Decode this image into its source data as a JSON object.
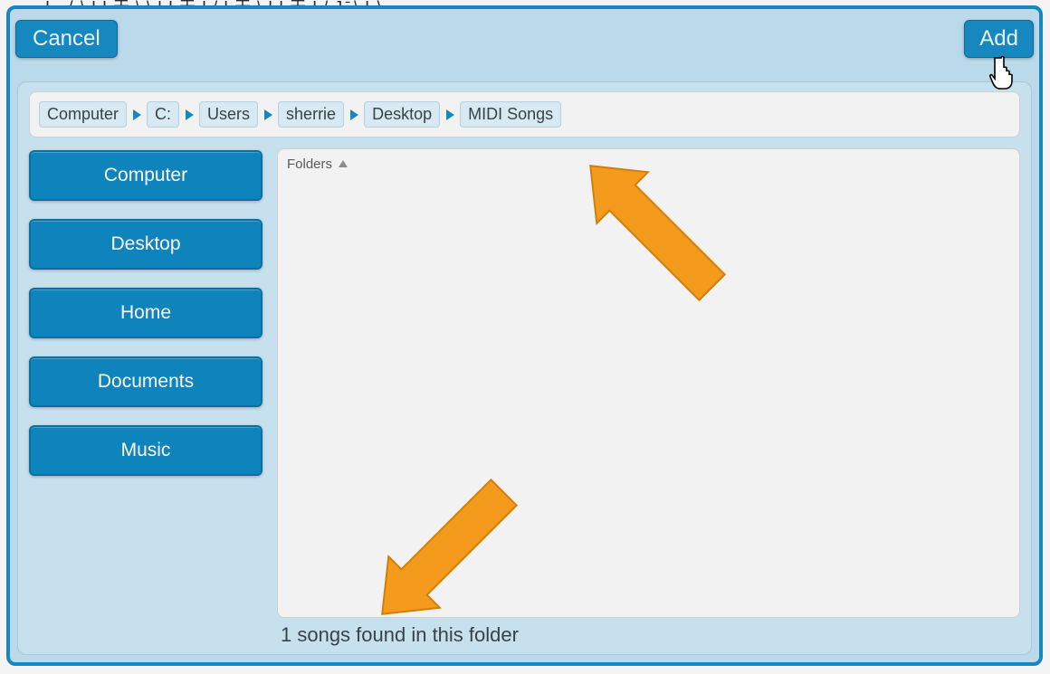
{
  "header": {
    "cancel": "Cancel",
    "add": "Add"
  },
  "breadcrumbs": [
    "Computer",
    "C:",
    "Users",
    "sherrie",
    "Desktop",
    "MIDI Songs"
  ],
  "sidebar": {
    "items": [
      "Computer",
      "Desktop",
      "Home",
      "Documents",
      "Music"
    ]
  },
  "folder_list": {
    "header": "Folders"
  },
  "status": "1 songs found in this folder",
  "obscured_top_text": "I ․ ⟨ \\ I I 天 \\ \\ I I 天 I / I 天 \\ I I 天 I / J ̄ \\ I ⟩"
}
